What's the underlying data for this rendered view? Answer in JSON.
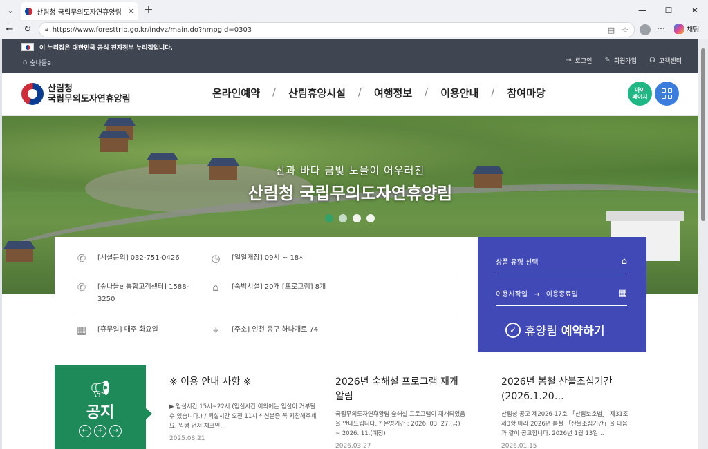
{
  "browser": {
    "tab_title": "산림청 국립무의도자연휴양림",
    "url": "https://www.foresttrip.go.kr/indvz/main.do?hmpgId=0303",
    "copilot_label": "채팅"
  },
  "gov_banner": {
    "text": "이 누리집은 대한민국 공식 전자정부 누리집입니다.",
    "home_label": "숲나들e",
    "login": "로그인",
    "signup": "회원가입",
    "support": "고객센터"
  },
  "header": {
    "logo_line1": "산림청",
    "logo_line2": "국립무의도자연휴양림",
    "nav": [
      "온라인예약",
      "산림휴양시설",
      "여행정보",
      "이용안내",
      "참여마당"
    ],
    "mypage": "마이\n페이지"
  },
  "hero": {
    "subtitle": "산과 바다 금빛 노을이 어우러진",
    "title": "산림청 국립무의도자연휴양림"
  },
  "info": {
    "phone": "[시설문의] 032-751-0426",
    "hours": "[일일개장] 09시 ~ 18시",
    "callcenter": "[숲나들e 통합고객센터] 1588-3250",
    "facility": "[숙박시설] 20개 [프로그램] 8개",
    "closed": "[휴무일] 매주 화요일",
    "address": "[주소] 인천 중구 하나개로 74"
  },
  "reservation": {
    "product_select": "상품 유형 선택",
    "date_start": "이용시작일",
    "date_end": "이용종료일",
    "arrow": "→",
    "cta_light": "휴양림",
    "cta_bold": "예약하기"
  },
  "notice": {
    "label": "공지",
    "posts": [
      {
        "title": "※ 이용 안내 사항 ※",
        "body": "▶ 입실시간 15시~22시 (입실시간 이외에는 입실이 거부될 수 있습니다.) / 퇴실시간 오전 11시 * 신분증 꼭 지참해주세요. 일행 먼저 체크인…",
        "date": "2025.08.21"
      },
      {
        "title": "2026년 숲해설 프로그램 재개 알림",
        "body": "국립무의도자연휴양림 숲해설 프로그램이 재개되었음을 안내드립니다. * 운영기간 : 2026. 03. 27.(금) ~ 2026. 11.(예정)",
        "date": "2026.03.27"
      },
      {
        "title": "2026년 봄철 산불조심기간 (2026.1.20…",
        "body": "산림청 공고 제2026-17호 「산림보호법」 제31조 제3항 따라 2026년 봄철 「산불조심기간」을 다음과 같이 공고합니다. 2026년 1월 13일…",
        "date": "2026.01.15"
      }
    ]
  },
  "colors": {
    "gov_bar": "#3f4652",
    "reservation": "#4049b6",
    "notice": "#1e8a5a",
    "mypage": "#1fb884",
    "allmenu": "#3b7ddd"
  }
}
